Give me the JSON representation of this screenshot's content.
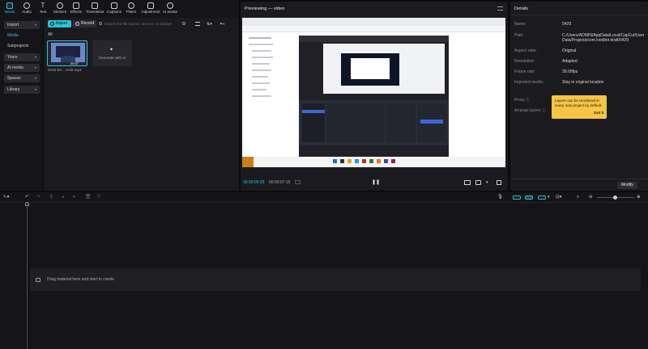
{
  "toolbar": {
    "items": [
      {
        "label": "Media",
        "icon": "media-icon"
      },
      {
        "label": "Audio",
        "icon": "audio-icon"
      },
      {
        "label": "Text",
        "icon": "text-icon"
      },
      {
        "label": "Stickers",
        "icon": "stickers-icon"
      },
      {
        "label": "Effects",
        "icon": "effects-icon"
      },
      {
        "label": "Transitions",
        "icon": "transitions-icon"
      },
      {
        "label": "Captions",
        "icon": "captions-icon"
      },
      {
        "label": "Filters",
        "icon": "filters-icon"
      },
      {
        "label": "Adjustment",
        "icon": "adjustment-icon"
      },
      {
        "label": "AI avatar",
        "icon": "ai-avatar-icon"
      }
    ]
  },
  "leftnav": {
    "import": "Import",
    "media": "Media",
    "subprojects": "Subprojects",
    "yours": "Yours",
    "ai_media": "AI media",
    "spaces": "Spaces",
    "library": "Library"
  },
  "media": {
    "import_btn": "Import",
    "record_btn": "Record",
    "search_placeholder": "Search for file names, scenes, or dialogs",
    "filter_all": "All",
    "clip_name": "2026-04-...3-06.mp4",
    "clip_duration": "00:07",
    "generate_label": "Generate with AI"
  },
  "preview": {
    "title": "Previewing — video",
    "current_time": "00:00:00:03",
    "total_time": "00:00:07:15"
  },
  "details": {
    "header": "Details",
    "rows": [
      {
        "label": "Name:",
        "value": "0429"
      },
      {
        "label": "Path:",
        "value": "C:/Users/ADMIN/AppData/Local/CapCut/User Data/Projects/com.lveditor.draft/0429"
      },
      {
        "label": "Aspect ratio:",
        "value": "Original"
      },
      {
        "label": "Resolution:",
        "value": "Adapted"
      },
      {
        "label": "Frame rate:",
        "value": "30.00fps"
      },
      {
        "label": "Imported media:",
        "value": "Stay in original location"
      }
    ],
    "proxy_label": "Proxy",
    "arrange_label": "Arrange layers",
    "tooltip_text": "Layers can be reordered in every new project by default.",
    "tooltip_btn": "Got it",
    "modify_btn": "Modify"
  },
  "timeline": {
    "drop_hint": "Drag material here and start to create"
  },
  "colors": {
    "accent": "#29c3d6",
    "tooltip": "#f6c544"
  }
}
